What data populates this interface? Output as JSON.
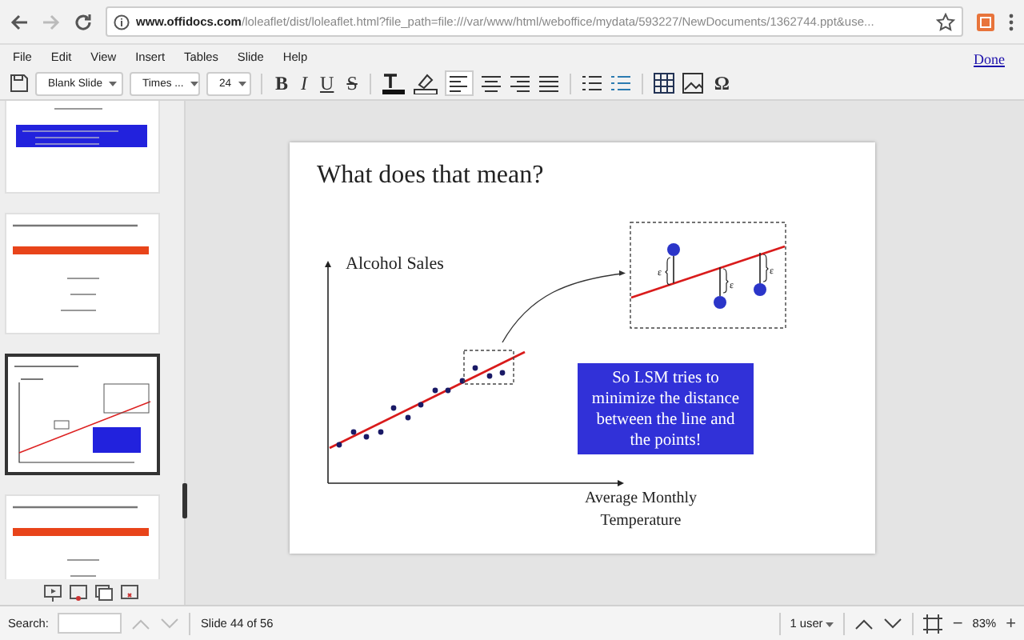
{
  "browser": {
    "url": "**www.offidocs.com**/loleaflet/dist/loleaflet.html?file_path=file:///var/www/html/weboffice/mydata/593227/NewDocuments/1362744.ppt&use..."
  },
  "menu": [
    "File",
    "Edit",
    "View",
    "Insert",
    "Tables",
    "Slide",
    "Help"
  ],
  "done": "Done",
  "toolbar": {
    "dropdowns": [
      "Blank Slide",
      "Times ...",
      "24"
    ],
    "format_buttons": [
      "B",
      "I",
      "U",
      "S"
    ],
    "special": "Ω"
  },
  "slides": [
    {
      "kind": "where",
      "selected": false
    },
    {
      "kind": "formula",
      "selected": false
    },
    {
      "kind": "chart",
      "selected": true
    },
    {
      "kind": "formula",
      "selected": false
    }
  ],
  "slide": {
    "title": "What does that mean?",
    "y_label": "Alcohol Sales",
    "x_label": "Average Monthly Temperature",
    "callout": "So LSM tries to minimize the distance between the line and the points!",
    "epsilons": [
      "ε",
      "ε",
      "ε"
    ]
  },
  "status_bar": {
    "search_label": "Search:",
    "slide_info": "Slide 44 of 56",
    "users": "1 user",
    "zoom": "83%",
    "zoom_out": "−",
    "zoom_in": "+"
  }
}
